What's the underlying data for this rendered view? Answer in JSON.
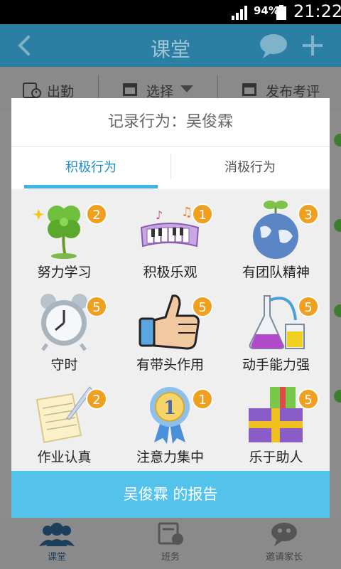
{
  "status_bar": {
    "battery": "94%",
    "time": "21:22"
  },
  "app_bar": {
    "title": "课堂"
  },
  "toolbar": {
    "attendance": "出勤",
    "select": "选择",
    "publish": "发布考评"
  },
  "dialog": {
    "title": "记录行为：吴俊霖",
    "tabs": [
      {
        "label": "积极行为"
      },
      {
        "label": "消极行为"
      }
    ],
    "behaviors": [
      {
        "label": "努力学习",
        "count": "2",
        "icon": "clover-icon"
      },
      {
        "label": "积极乐观",
        "count": "1",
        "icon": "piano-icon"
      },
      {
        "label": "有团队精神",
        "count": "3",
        "icon": "globe-sprout-icon"
      },
      {
        "label": "守时",
        "count": "5",
        "icon": "alarm-clock-icon"
      },
      {
        "label": "有带头作用",
        "count": "5",
        "icon": "thumbs-up-icon"
      },
      {
        "label": "动手能力强",
        "count": "5",
        "icon": "lab-flask-icon"
      },
      {
        "label": "作业认真",
        "count": "2",
        "icon": "paper-quill-icon"
      },
      {
        "label": "注意力集中",
        "count": "1",
        "icon": "medal-icon"
      },
      {
        "label": "乐于助人",
        "count": "5",
        "icon": "gift-box-icon"
      }
    ],
    "report_button": "吴俊霖 的报告"
  },
  "bottom_nav": [
    {
      "label": "课堂",
      "icon": "people-icon"
    },
    {
      "label": "班务",
      "icon": "class-affairs-icon"
    },
    {
      "label": "邀请家长",
      "icon": "invite-parents-icon"
    }
  ],
  "colors": {
    "accent": "#54c3ec",
    "badge": "#f0a020",
    "appbar": "#2b7fa3"
  }
}
